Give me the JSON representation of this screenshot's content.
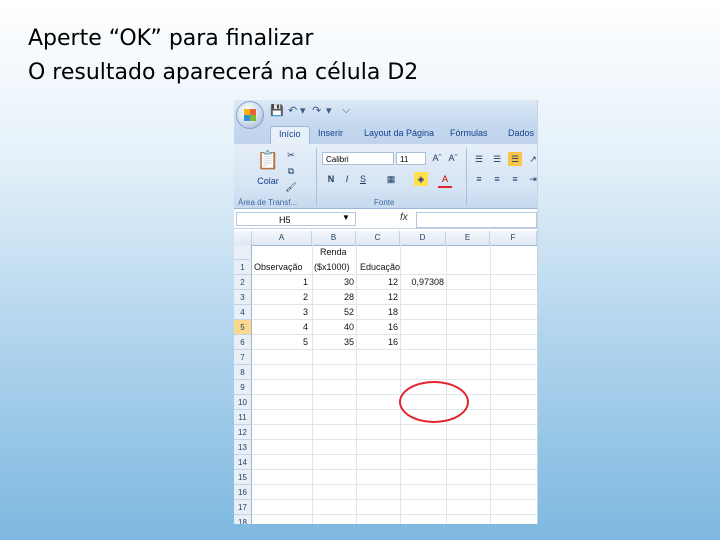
{
  "slide": {
    "line1": "Aperte “OK” para finalizar",
    "line2": "O resultado aparecerá na célula D2"
  },
  "excel": {
    "qat": {
      "save_icon": "save-icon",
      "undo_icon": "undo-icon",
      "redo_icon": "redo-icon"
    },
    "tabs": [
      "Início",
      "Inserir",
      "Layout da Página",
      "Fórmulas",
      "Dados"
    ],
    "ribbon": {
      "paste_label": "Colar",
      "clipboard_group": "Área de Transf...",
      "font_name": "Calibri",
      "font_size": "11",
      "bold": "N",
      "italic": "I",
      "underline": "S",
      "font_group": "Fonte"
    },
    "formula_bar": {
      "name_box": "H5",
      "fx": "fx",
      "value": ""
    },
    "columns": [
      "A",
      "B",
      "C",
      "D",
      "E",
      "F"
    ],
    "rows": [
      "1",
      "2",
      "3",
      "4",
      "5",
      "6",
      "7",
      "8",
      "9",
      "10",
      "11",
      "12",
      "13",
      "14",
      "15",
      "16",
      "17",
      "18"
    ],
    "selected_row": "5",
    "header_row": {
      "renda_top": "Renda",
      "a1": "Observação",
      "b1": "($x1000)",
      "c1": "Educação"
    },
    "data": [
      {
        "a": "1",
        "b": "30",
        "c": "12",
        "d": "0,97308"
      },
      {
        "a": "2",
        "b": "28",
        "c": "12",
        "d": ""
      },
      {
        "a": "3",
        "b": "52",
        "c": "18",
        "d": ""
      },
      {
        "a": "4",
        "b": "40",
        "c": "16",
        "d": ""
      },
      {
        "a": "5",
        "b": "35",
        "c": "16",
        "d": ""
      }
    ],
    "highlight_color": "#e0262c"
  }
}
